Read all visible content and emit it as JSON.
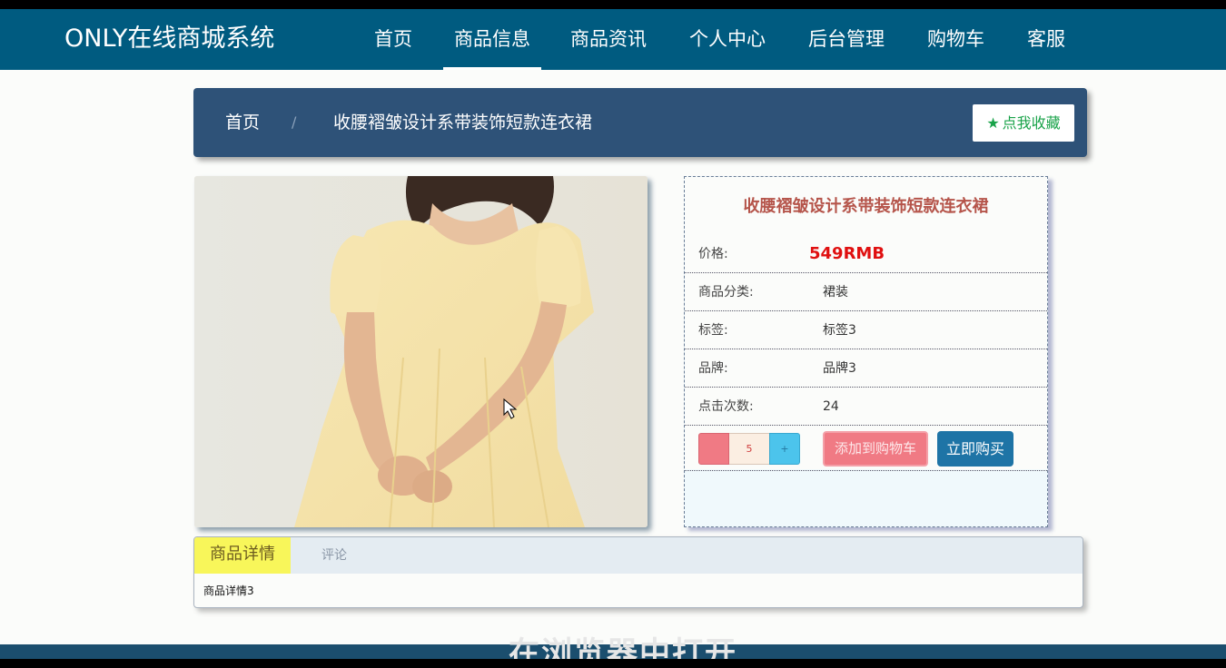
{
  "header": {
    "brand": "ONLY在线商城系统",
    "nav": [
      {
        "label": "首页"
      },
      {
        "label": "商品信息",
        "active": true
      },
      {
        "label": "商品资讯"
      },
      {
        "label": "个人中心"
      },
      {
        "label": "后台管理"
      },
      {
        "label": "购物车"
      },
      {
        "label": "客服"
      }
    ]
  },
  "breadcrumb": {
    "home": "首页",
    "separator": "/",
    "current": "收腰褶皱设计系带装饰短款连衣裙",
    "favorite_label": "点我收藏",
    "favorite_icon": "star-icon"
  },
  "product": {
    "title": "收腰褶皱设计系带装饰短款连衣裙",
    "fields": [
      {
        "label": "价格:",
        "value": "549RMB"
      },
      {
        "label": "商品分类:",
        "value": "裙装"
      },
      {
        "label": "标签:",
        "value": "标签3"
      },
      {
        "label": "品牌:",
        "value": "品牌3"
      },
      {
        "label": "点击次数:",
        "value": "24"
      }
    ],
    "quantity": "5",
    "plus_label": "+",
    "add_to_cart": "添加到购物车",
    "buy_now": "立即购买"
  },
  "tabs": {
    "items": [
      {
        "label": "商品详情",
        "active": true
      },
      {
        "label": "评论"
      }
    ],
    "content": "商品详情3"
  },
  "overlay": {
    "subtitle": "在浏览器中打开"
  },
  "colors": {
    "nav_bg": "#005b80",
    "breadcrumb_bg": "#2e5278",
    "price": "#e01010",
    "favorite": "#1aa34a",
    "add_cart": "#f07a84",
    "buy_now": "#1e74a6",
    "active_tab": "#f8f65a"
  }
}
